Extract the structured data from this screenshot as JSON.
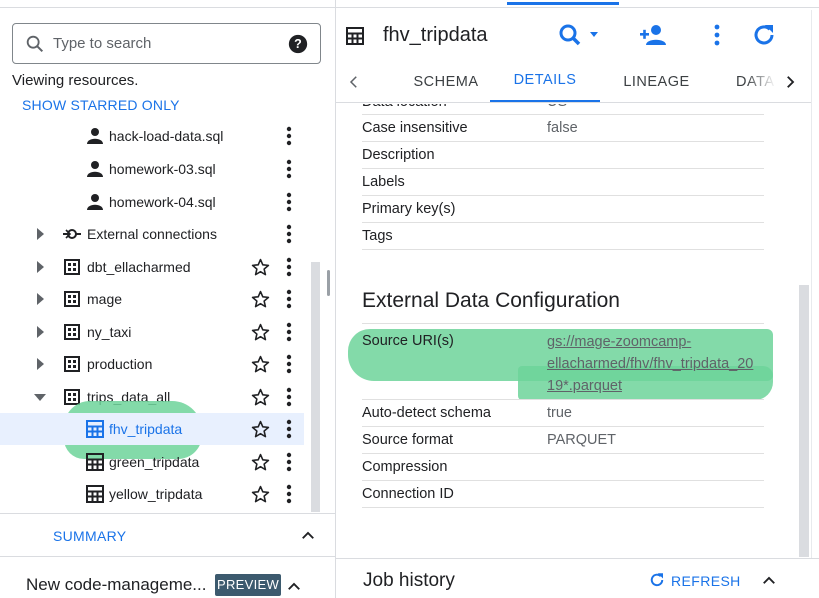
{
  "left": {
    "search": {
      "placeholder": "Type to search"
    },
    "viewing_text": "Viewing resources.",
    "show_starred": "SHOW STARRED ONLY",
    "tree": [
      {
        "label": "hack-load-data.sql",
        "icon": "person-icon",
        "expandable": false,
        "starrable": false,
        "selected": false
      },
      {
        "label": "homework-03.sql",
        "icon": "person-icon",
        "expandable": false,
        "starrable": false,
        "selected": false
      },
      {
        "label": "homework-04.sql",
        "icon": "person-icon",
        "expandable": false,
        "starrable": false,
        "selected": false
      },
      {
        "label": "External connections",
        "icon": "external-connection-icon",
        "expandable": true,
        "expanded": false,
        "starrable": false,
        "selected": false
      },
      {
        "label": "dbt_ellacharmed",
        "icon": "dataset-icon",
        "expandable": true,
        "expanded": false,
        "starrable": true,
        "selected": false
      },
      {
        "label": "mage",
        "icon": "dataset-icon",
        "expandable": true,
        "expanded": false,
        "starrable": true,
        "selected": false
      },
      {
        "label": "ny_taxi",
        "icon": "dataset-icon",
        "expandable": true,
        "expanded": false,
        "starrable": true,
        "selected": false
      },
      {
        "label": "production",
        "icon": "dataset-icon",
        "expandable": true,
        "expanded": false,
        "starrable": true,
        "selected": false
      },
      {
        "label": "trips_data_all",
        "icon": "dataset-icon",
        "expandable": true,
        "expanded": true,
        "starrable": true,
        "selected": false
      },
      {
        "label": "fhv_tripdata",
        "icon": "table-icon",
        "expandable": false,
        "starrable": true,
        "selected": true
      },
      {
        "label": "green_tripdata",
        "icon": "table-icon",
        "expandable": false,
        "starrable": true,
        "selected": false
      },
      {
        "label": "yellow_tripdata",
        "icon": "table-icon",
        "expandable": false,
        "starrable": true,
        "selected": false
      }
    ],
    "summary_label": "SUMMARY",
    "new_code_label": "New code-manageme...",
    "preview_badge": "PREVIEW"
  },
  "right": {
    "title": "fhv_tripdata",
    "tabs": [
      {
        "label": "SCHEMA",
        "active": false
      },
      {
        "label": "DETAILS",
        "active": true
      },
      {
        "label": "LINEAGE",
        "active": false
      },
      {
        "label": "DATA",
        "active": false
      }
    ],
    "details_partial": {
      "key": "Data location",
      "value": "US"
    },
    "details": [
      {
        "key": "Case insensitive",
        "value": "false"
      },
      {
        "key": "Description",
        "value": ""
      },
      {
        "key": "Labels",
        "value": ""
      },
      {
        "key": "Primary key(s)",
        "value": ""
      },
      {
        "key": "Tags",
        "value": ""
      }
    ],
    "external_config_title": "External Data Configuration",
    "source_uri": {
      "key": "Source URI(s)",
      "value": "gs://mage-zoomcamp-ellacharmed/fhv/fhv_tripdata_2019*.parquet",
      "lines": [
        "gs://mage-zoomcamp-",
        "ellacharmed/fhv/fhv_tripdata_20",
        "19*.parquet"
      ]
    },
    "external_details": [
      {
        "key": "Auto-detect schema",
        "value": "true"
      },
      {
        "key": "Source format",
        "value": "PARQUET"
      },
      {
        "key": "Compression",
        "value": ""
      },
      {
        "key": "Connection ID",
        "value": ""
      }
    ],
    "job_history_label": "Job history",
    "refresh_label": "REFRESH"
  },
  "colors": {
    "accent": "#1a73e8",
    "highlight": "#6dd49a",
    "selected_row": "#e8f0fe",
    "badge": "#3c5a6e"
  }
}
